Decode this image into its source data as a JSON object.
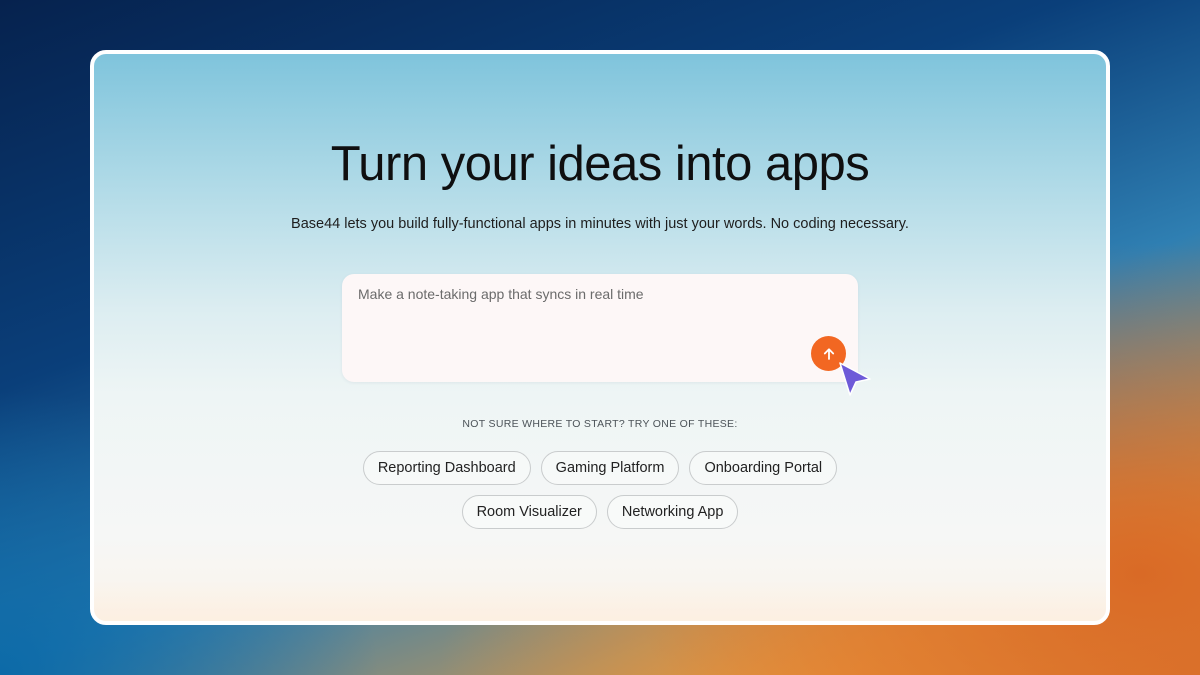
{
  "hero": {
    "title": "Turn your ideas into apps",
    "subtitle": "Base44 lets you build fully-functional apps in minutes with just your words. No coding necessary."
  },
  "prompt": {
    "value": "Make a note-taking app that syncs in real time",
    "send_icon": "arrow-up-icon"
  },
  "suggestions": {
    "heading": "NOT SURE WHERE TO START? TRY ONE OF THESE:",
    "row1": [
      "Reporting Dashboard",
      "Gaming Platform",
      "Onboarding Portal"
    ],
    "row2": [
      "Room Visualizer",
      "Networking App"
    ]
  },
  "colors": {
    "accent": "#f26722",
    "cursor": "#6e5ad8"
  }
}
